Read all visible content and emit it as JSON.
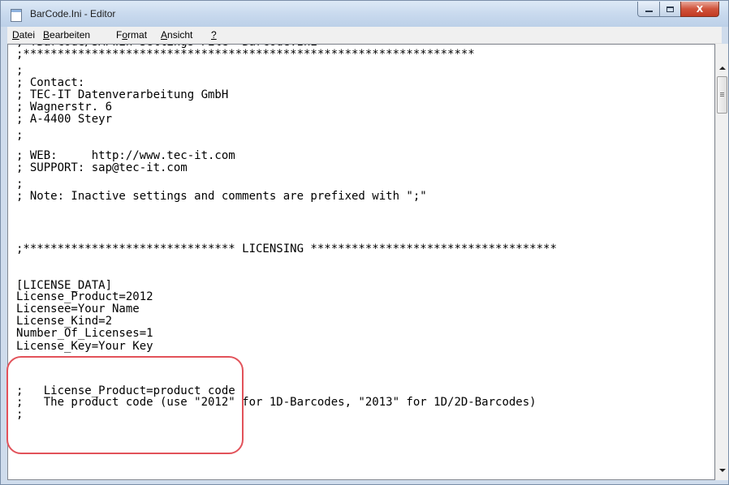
{
  "window": {
    "title": "BarCode.Ini - Editor",
    "minimize_label": "",
    "maximize_label": "",
    "close_label": "X"
  },
  "menu": {
    "items": [
      {
        "accel": "D",
        "rest": "atei"
      },
      {
        "accel": "B",
        "rest": "earbeiten"
      },
      {
        "pre": "F",
        "accel": "o",
        "rest": "rmat"
      },
      {
        "accel": "A",
        "rest": "nsicht"
      },
      {
        "accel": "?",
        "rest": ""
      }
    ]
  },
  "editor": {
    "lines": [
      ";******************************************************************",
      "; TBarCode/SAPwin Settings File \"BarCode.Ini\"",
      ";******************************************************************",
      ";",
      "; Contact:",
      "; TEC-IT Datenverarbeitung GmbH",
      "; Wagnerstr. 6",
      "; A-4400 Steyr",
      ";",
      "; WEB:     http://www.tec-it.com",
      "; SUPPORT: sap@tec-it.com",
      ";",
      "; Note: Inactive settings and comments are prefixed with \";\"",
      "",
      "",
      "",
      ";******************************* LICENSING ************************************",
      "",
      "[LICENSE_DATA]",
      "License_Product=2012",
      "Licensee=Your Name",
      "License_Kind=2",
      "Number_Of_Licenses=1",
      "License_Key=Your Key",
      "",
      "",
      ";   License_Product=product code",
      ";   The product code (use \"2012\" for 1D-Barcodes, \"2013\" for 1D/2D-Barcodes)",
      ";"
    ]
  },
  "colors": {
    "highlight_ring": "#e2525a",
    "titlebar": "#c9daee",
    "close_button": "#c23a22"
  }
}
